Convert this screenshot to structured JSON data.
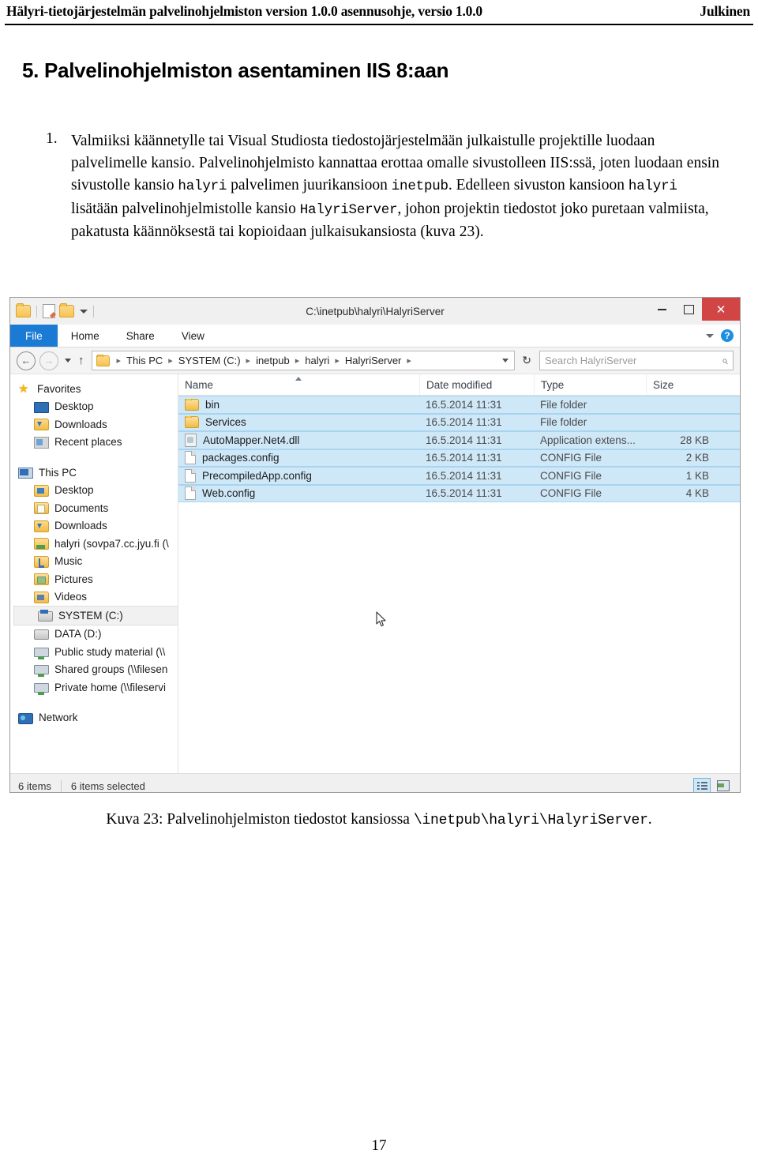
{
  "document": {
    "header_left": "Hälyri-tietojärjestelmän palvelinohjelmiston version 1.0.0 asennusohje, versio 1.0.0",
    "header_right": "Julkinen",
    "section_heading": "5. Palvelinohjelmiston asentaminen IIS 8:aan",
    "page_number": "17"
  },
  "paragraph": {
    "number": "1.",
    "part1": "Valmiiksi käännetylle tai Visual Studiosta tiedostojärjestelmään julkaistulle projektille luodaan palvelimelle kansio. Palvelinohjelmisto kannattaa erottaa omalle sivustolleen IIS:ssä, joten luodaan ensin sivustolle kansio ",
    "mono1": "halyri",
    "part2": " palvelimen juurikansioon ",
    "mono2": "inetpub",
    "part3": ". Edelleen sivuston kansioon ",
    "mono3": "halyri",
    "part4": " lisätään palvelinohjelmistolle kansio ",
    "mono4": "HalyriServer",
    "part5": ", johon projektin tiedostot joko puretaan valmiista, pakatusta käännöksestä tai kopioidaan julkaisukansiosta (kuva 23)."
  },
  "caption": {
    "prefix": "Kuva 23: Palvelinohjelmiston tiedostot kansiossa ",
    "path": "\\inetpub\\halyri\\HalyriServer",
    "suffix": "."
  },
  "explorer": {
    "title": "C:\\inetpub\\halyri\\HalyriServer",
    "quick_access": {
      "folder_icon": "folder-icon",
      "properties_icon": "properties-icon",
      "new_folder_icon": "new-folder-icon",
      "dropdown_icon": "chevron-down-icon"
    },
    "window_controls": {
      "minimize": "minimize-icon",
      "restore": "restore-icon",
      "close": "✕"
    },
    "ribbon_tabs": [
      {
        "label": "File",
        "active": true
      },
      {
        "label": "Home",
        "active": false
      },
      {
        "label": "Share",
        "active": false
      },
      {
        "label": "View",
        "active": false
      }
    ],
    "ribbon_right": {
      "collapse_icon": "chevron-down-icon",
      "help_label": "?"
    },
    "address_bar": {
      "back_icon": "←",
      "forward_icon": "→",
      "recent_icon": "chevron-down-icon",
      "up_icon": "↑",
      "breadcrumb_separator": "▸",
      "breadcrumb": [
        "This PC",
        "SYSTEM (C:)",
        "inetpub",
        "halyri",
        "HalyriServer"
      ],
      "refresh_icon": "↻",
      "search_placeholder": "Search HalyriServer",
      "search_value": "",
      "search_icon": "⌕"
    },
    "nav_pane": [
      {
        "label": "Favorites",
        "level": 0,
        "icon": "star-icon",
        "gap": false,
        "selected": false
      },
      {
        "label": "Desktop",
        "level": 1,
        "icon": "monitor-icon",
        "gap": false,
        "selected": false
      },
      {
        "label": "Downloads",
        "level": 1,
        "icon": "downloads-icon",
        "gap": false,
        "selected": false
      },
      {
        "label": "Recent places",
        "level": 1,
        "icon": "recent-places-icon",
        "gap": false,
        "selected": false
      },
      {
        "label": "This PC",
        "level": 0,
        "icon": "this-pc-icon",
        "gap": true,
        "selected": false
      },
      {
        "label": "Desktop",
        "level": 1,
        "icon": "folder-desktop-icon",
        "gap": false,
        "selected": false
      },
      {
        "label": "Documents",
        "level": 1,
        "icon": "folder-docs-icon",
        "gap": false,
        "selected": false
      },
      {
        "label": "Downloads",
        "level": 1,
        "icon": "downloads-icon",
        "gap": false,
        "selected": false
      },
      {
        "label": "halyri (sovpa7.cc.jyu.fi (\\",
        "level": 1,
        "icon": "network-folder-icon",
        "gap": false,
        "selected": false
      },
      {
        "label": "Music",
        "level": 1,
        "icon": "folder-music-icon",
        "gap": false,
        "selected": false
      },
      {
        "label": "Pictures",
        "level": 1,
        "icon": "folder-pictures-icon",
        "gap": false,
        "selected": false
      },
      {
        "label": "Videos",
        "level": 1,
        "icon": "folder-videos-icon",
        "gap": false,
        "selected": false
      },
      {
        "label": "SYSTEM (C:)",
        "level": 1,
        "icon": "system-drive-icon",
        "gap": false,
        "selected": true
      },
      {
        "label": "DATA (D:)",
        "level": 1,
        "icon": "drive-icon",
        "gap": false,
        "selected": false
      },
      {
        "label": "Public study material (\\\\",
        "level": 1,
        "icon": "network-drive-icon",
        "gap": false,
        "selected": false
      },
      {
        "label": "Shared groups (\\\\filesen",
        "level": 1,
        "icon": "network-drive-icon",
        "gap": false,
        "selected": false
      },
      {
        "label": "Private home (\\\\fileservi",
        "level": 1,
        "icon": "network-drive-icon",
        "gap": false,
        "selected": false
      },
      {
        "label": "Network",
        "level": 0,
        "icon": "network-icon",
        "gap": true,
        "selected": false
      }
    ],
    "columns": [
      "Name",
      "Date modified",
      "Type",
      "Size"
    ],
    "files": [
      {
        "name": "bin",
        "date": "16.5.2014 11:31",
        "type": "File folder",
        "size": "",
        "icon": "folder-icon",
        "selected": true
      },
      {
        "name": "Services",
        "date": "16.5.2014 11:31",
        "type": "File folder",
        "size": "",
        "icon": "folder-icon",
        "selected": true
      },
      {
        "name": "AutoMapper.Net4.dll",
        "date": "16.5.2014 11:31",
        "type": "Application extens...",
        "size": "28 KB",
        "icon": "dll-file-icon",
        "selected": true
      },
      {
        "name": "packages.config",
        "date": "16.5.2014 11:31",
        "type": "CONFIG File",
        "size": "2 KB",
        "icon": "config-file-icon",
        "selected": true
      },
      {
        "name": "PrecompiledApp.config",
        "date": "16.5.2014 11:31",
        "type": "CONFIG File",
        "size": "1 KB",
        "icon": "config-file-icon",
        "selected": true
      },
      {
        "name": "Web.config",
        "date": "16.5.2014 11:31",
        "type": "CONFIG File",
        "size": "4 KB",
        "icon": "config-file-icon",
        "selected": true
      }
    ],
    "status_bar": {
      "item_count": "6 items",
      "selection_count": "6 items selected",
      "details_view_icon": "details-view-icon",
      "large_icons_view_icon": "large-icons-view-icon"
    },
    "colors": {
      "file_tab_blue": "#1a7ad4",
      "close_red": "#d14545",
      "selection_blue": "#cfe8f8",
      "help_blue": "#1e8fe0"
    }
  }
}
